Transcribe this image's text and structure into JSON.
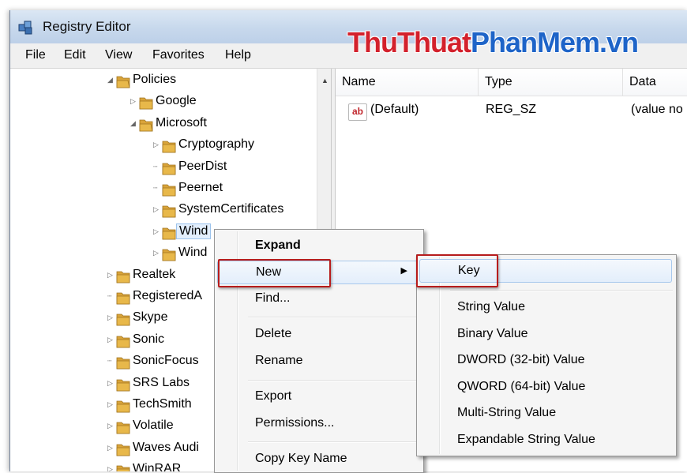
{
  "window": {
    "title": "Registry Editor"
  },
  "brand": {
    "part1": "ThuThuat",
    "part2": "PhanMem.vn"
  },
  "menubar": {
    "items": [
      "File",
      "Edit",
      "View",
      "Favorites",
      "Help"
    ]
  },
  "tree": {
    "items": [
      {
        "label": "Policies",
        "state": "expanded"
      },
      {
        "label": "Google",
        "state": "collapsed"
      },
      {
        "label": "Microsoft",
        "state": "expanded"
      },
      {
        "label": "Cryptography",
        "state": "collapsed"
      },
      {
        "label": "PeerDist",
        "state": "leaf"
      },
      {
        "label": "Peernet",
        "state": "leaf"
      },
      {
        "label": "SystemCertificates",
        "state": "collapsed"
      },
      {
        "label": "Wind",
        "state": "collapsed",
        "selected": true
      },
      {
        "label": "Wind",
        "state": "collapsed"
      },
      {
        "label": "Realtek",
        "state": "collapsed"
      },
      {
        "label": "RegisteredA",
        "state": "leaf"
      },
      {
        "label": "Skype",
        "state": "collapsed"
      },
      {
        "label": "Sonic",
        "state": "collapsed"
      },
      {
        "label": "SonicFocus",
        "state": "leaf"
      },
      {
        "label": "SRS Labs",
        "state": "collapsed"
      },
      {
        "label": "TechSmith",
        "state": "collapsed"
      },
      {
        "label": "Volatile",
        "state": "collapsed"
      },
      {
        "label": "Waves Audi",
        "state": "collapsed"
      },
      {
        "label": "WinRAR",
        "state": "collapsed"
      }
    ]
  },
  "list": {
    "columns": [
      "Name",
      "Type",
      "Data"
    ],
    "rows": [
      {
        "name": "(Default)",
        "type": "REG_SZ",
        "data": "(value no"
      }
    ],
    "icon_text": "ab"
  },
  "context_menu": {
    "expand": "Expand",
    "new": "New",
    "find": "Find...",
    "delete": "Delete",
    "rename": "Rename",
    "export": "Export",
    "permissions": "Permissions...",
    "copy_key_name": "Copy Key Name"
  },
  "submenu": {
    "key": "Key",
    "string_value": "String Value",
    "binary_value": "Binary Value",
    "dword_value": "DWORD (32-bit) Value",
    "qword_value": "QWORD (64-bit) Value",
    "multi_string_value": "Multi-String Value",
    "expandable_string_value": "Expandable String Value"
  },
  "colors": {
    "highlight_box": "#b71c1c",
    "folder": "#e8b84a"
  }
}
